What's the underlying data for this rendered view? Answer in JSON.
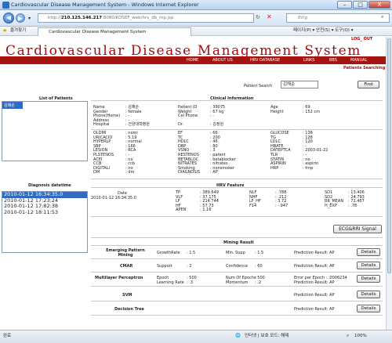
{
  "window": {
    "title": "Cardiovascular Disease Management System - Windows Internet Explorer",
    "min": "–",
    "max": "□",
    "close": "X"
  },
  "browser": {
    "url_prefix": "http://",
    "url_host": "210.125.146.217",
    "url_rest": ":8080/KOSEF_web/hrv_db_mp.jsp",
    "search_engine": "Bing",
    "favorites": "즐겨찾기",
    "tab": "Cardiovascular Disease Management System",
    "tools": "페이지(P) ▾  안전(S) ▾  도구(O) ▾"
  },
  "status": {
    "left": "완료",
    "zone": "인터넷 | 보호 모드: 해제",
    "zoom": "100%"
  },
  "site": {
    "title": "Cardiovascular Disease Management System",
    "logout": "LOG_ OUT",
    "patient_searching": "Patients Searching"
  },
  "menu": [
    "HOME",
    "ABOUT US",
    "HRV DATABASE",
    "LINKS",
    "BBS",
    "MANUAL"
  ],
  "search": {
    "label": "Patient Search",
    "value": "김채순",
    "button": "Find"
  },
  "list_of_patients": {
    "title": "List of Patients",
    "items": [
      "김채순"
    ]
  },
  "clinical": {
    "title": "Clinical Information",
    "labels_a": [
      "Name",
      "Gender",
      "Phone(Home)",
      "Address",
      "Hospital"
    ],
    "values_a": [
      ": 김채순",
      ": female",
      ": -",
      ": -",
      ": 건양대학병원"
    ],
    "labels_b": [
      "Patient ID",
      "Weight",
      "Cel Phone",
      "",
      "Dr."
    ],
    "values_b": [
      ": 39075",
      ": 67 kg",
      ": -",
      "",
      ": 김정원"
    ],
    "labels_c": [
      "Age",
      "Height",
      "",
      "",
      ""
    ],
    "values_c": [
      ": 69",
      ": 152 cm",
      "",
      "",
      ""
    ],
    "g1_labels": [
      "OLDMI",
      "URICACID",
      "HYPERLP",
      "SBP",
      "LESION",
      "PLSTENOS",
      "ACEI",
      "CCB",
      "DIGITALI",
      "DM"
    ],
    "g1_values": [
      ": nomi",
      ": 5.19",
      ": normal",
      ": 166",
      ": RCA",
      ": -",
      ": no",
      ": ccb",
      ": no",
      ": dm"
    ],
    "g2_labels": [
      "EF",
      "TC",
      "HDLC",
      "DBP",
      "VSNO",
      "RESTENOS",
      "BETABLOC",
      "NITRATES",
      "Smoking",
      "DIAGNOSIS"
    ],
    "g2_values": [
      ": 66",
      ": 200",
      ": 46",
      ": 80",
      ": 3",
      ": patent",
      ": betablocker",
      ": nitrates",
      ": nonsmoker",
      ": AP"
    ],
    "g3_labels": [
      "GLUCOSE",
      "TG",
      "LDLC",
      "HBATE",
      "DATEPTCA",
      "TLR",
      "STATIN",
      "ASPIRIN",
      "HRP",
      ""
    ],
    "g3_values": [
      ": 138",
      ": 128",
      ": 120",
      ": -",
      ": 2003-01-22",
      ": -",
      ": no",
      ": aspirin",
      ": frnp",
      ""
    ]
  },
  "diagnosis": {
    "title": "Diagnosis datetime",
    "items": [
      "2010-01-12 16:34:35.0",
      "2010-01-12 17:23:24",
      "2010-01-12 17:82:38",
      "2010-01-12 18:11:53"
    ]
  },
  "hrv": {
    "title": "HRV Feature",
    "date_label": "Date",
    "date_value": "2010-01-12 16:34:35.0",
    "l1": [
      "TP",
      "VLF",
      "LF",
      "HF",
      "APEN"
    ],
    "v1": [
      ": 389.649",
      ": 37.175",
      ": 214.744",
      ": 57.73",
      ": 1.16"
    ],
    "l2": [
      "NLF",
      "NHF",
      "LF_HF",
      "F14"
    ],
    "v2": [
      ": .788",
      ": .212",
      ": 3.72",
      ": -.947"
    ],
    "l3": [
      "SD1",
      "SD2",
      "RR_MEAN",
      "H_EXP"
    ],
    "v3": [
      ": 13.406",
      ": 24.793",
      ": 72.467",
      ": .78"
    ],
    "button": "ECG&RRI Signal"
  },
  "mining": {
    "title": "Mining Result",
    "rows": [
      {
        "name": "Emerging Pattern Mining",
        "p1l": "GrowthRate",
        "p1v": ": 1.5",
        "p2l": "Min. Supp",
        "p2v": ": 1.5",
        "pred": "Prediction Result: AP",
        "btn": "Details"
      },
      {
        "name": "CMAR",
        "p1l": "Support",
        "p1v": ": 2",
        "p2l": "Confidence",
        "p2v": ": 60",
        "pred": "Prediction Result: AP",
        "btn": "Details"
      },
      {
        "name": "Multilayer Perceptron",
        "p1l": "Epoch",
        "p1v": ": 500",
        "p2l": "Num Of Epochs",
        "p2v": ": 500",
        "p3l": "Learning Rate",
        "p3v": ": .3",
        "p4l": "Momentum",
        "p4v": ": .2",
        "pred": "Error per Epoch : .0006234",
        "pred2": "Prediction Result: AP",
        "btn": "Details"
      },
      {
        "name": "SVM",
        "pred": "Prediction Result: AP",
        "btn": "Details"
      },
      {
        "name": "Decision Tree",
        "pred": "Prediction Result: AP",
        "btn": "Details"
      }
    ]
  }
}
